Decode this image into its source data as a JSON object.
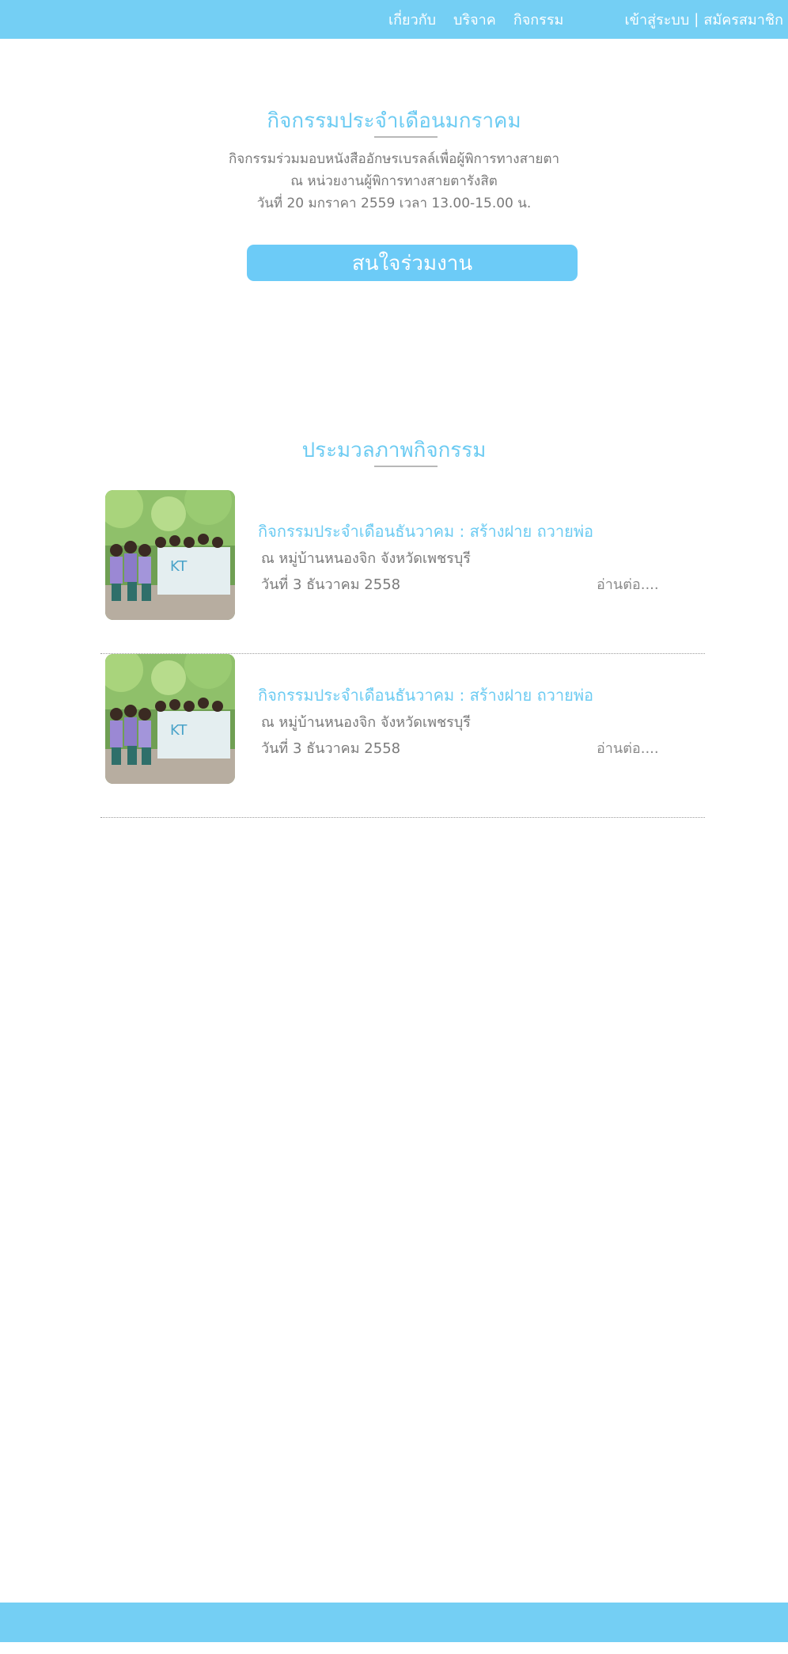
{
  "colors": {
    "header_bg": "#74cff4",
    "accent": "#6ccbf2",
    "body_text": "#7a7a7a",
    "button_bg": "#6ccbf7"
  },
  "nav": {
    "items": [
      {
        "label": "เกี่ยวกับ"
      },
      {
        "label": "บริจาค"
      },
      {
        "label": "กิจกรรม"
      }
    ],
    "login": "เข้าสู่ระบบ",
    "separator": "|",
    "register": "สมัครสมาชิก"
  },
  "event": {
    "title": "กิจกรรมประจำเดือนมกราคม",
    "line1": "กิจกรรมร่วมมอบหนังสืออักษรเบรลล์เพื่อผู้พิการทางสายตา",
    "line2": "ณ หน่วยงานผู้พิการทางสายตารังสิต",
    "line3": "วันที่ 20 มกราคา 2559 เวลา 13.00-15.00 น.",
    "button": "สนใจร่วมงาน"
  },
  "gallery": {
    "title": "ประมวลภาพกิจกรรม",
    "items": [
      {
        "title": "กิจกรรมประจำเดือนธันวาคม : สร้างฝาย ถวายพ่อ",
        "location": "ณ หมู่บ้านหนองจิก จังหวัดเพชรบุรี",
        "date": "วันที่ 3 ธันวาคม 2558",
        "read_more": "อ่านต่อ...."
      },
      {
        "title": "กิจกรรมประจำเดือนธันวาคม : สร้างฝาย ถวายพ่อ",
        "location": "ณ หมู่บ้านหนองจิก จังหวัดเพชรบุรี",
        "date": "วันที่ 3 ธันวาคม 2558",
        "read_more": "อ่านต่อ...."
      }
    ]
  }
}
